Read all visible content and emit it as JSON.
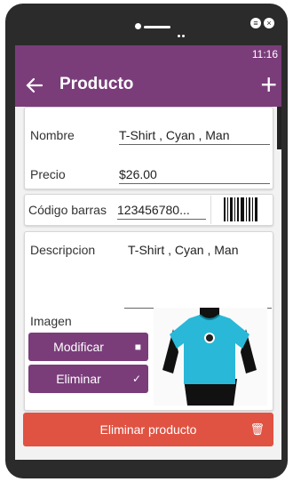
{
  "status": {
    "time": "11:16"
  },
  "toolbar": {
    "title": "Producto",
    "back_icon": "arrow-left-icon",
    "add_icon": "plus-icon"
  },
  "form": {
    "name_label": "Nombre",
    "name_value": "T-Shirt , Cyan , Man",
    "price_label": "Precio",
    "price_value": "$26.00",
    "barcode_label": "Código barras",
    "barcode_value": "123456780...",
    "description_label": "Descripcion",
    "description_value": "T-Shirt , Cyan , Man",
    "image_label": "Imagen"
  },
  "buttons": {
    "modify_label": "Modificar",
    "remove_label": "Eliminar",
    "delete_product_label": "Eliminar producto"
  },
  "colors": {
    "primary": "#7a3d7a",
    "danger": "#e05242",
    "shirt": "#29b8d8"
  }
}
